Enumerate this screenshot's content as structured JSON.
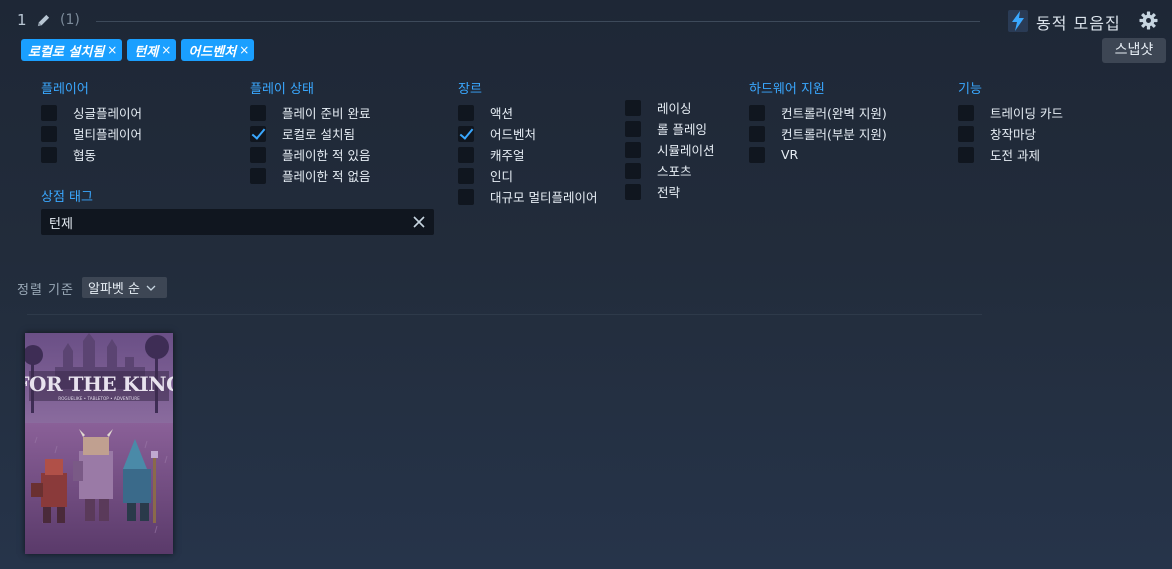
{
  "header": {
    "shelf_number": "1",
    "shelf_count": "(1)",
    "title": "동적 모음집",
    "snapshot_label": "스냅샷"
  },
  "chips": [
    {
      "label": "로컬로 설치됨",
      "remove": "×"
    },
    {
      "label": "턴제",
      "remove": "×"
    },
    {
      "label": "어드벤처",
      "remove": "×"
    }
  ],
  "filters": {
    "players": {
      "title": "플레이어",
      "options": [
        {
          "label": "싱글플레이어",
          "checked": false
        },
        {
          "label": "멀티플레이어",
          "checked": false
        },
        {
          "label": "협동",
          "checked": false
        }
      ]
    },
    "play_state": {
      "title": "플레이 상태",
      "options": [
        {
          "label": "플레이 준비 완료",
          "checked": false
        },
        {
          "label": "로컬로 설치됨",
          "checked": true
        },
        {
          "label": "플레이한 적 있음",
          "checked": false
        },
        {
          "label": "플레이한 적 없음",
          "checked": false
        }
      ]
    },
    "genre": {
      "title": "장르",
      "options_col1": [
        {
          "label": "액션",
          "checked": false
        },
        {
          "label": "어드벤처",
          "checked": true
        },
        {
          "label": "캐주얼",
          "checked": false
        },
        {
          "label": "인디",
          "checked": false
        },
        {
          "label": "대규모 멀티플레이어",
          "checked": false
        }
      ],
      "options_col2": [
        {
          "label": "레이싱",
          "checked": false
        },
        {
          "label": "롤 플레잉",
          "checked": false
        },
        {
          "label": "시뮬레이션",
          "checked": false
        },
        {
          "label": "스포츠",
          "checked": false
        },
        {
          "label": "전략",
          "checked": false
        }
      ]
    },
    "hardware": {
      "title": "하드웨어 지원",
      "options": [
        {
          "label": "컨트롤러(완벽 지원)",
          "checked": false
        },
        {
          "label": "컨트롤러(부분 지원)",
          "checked": false
        },
        {
          "label": "VR",
          "checked": false
        }
      ]
    },
    "features": {
      "title": "기능",
      "options": [
        {
          "label": "트레이딩 카드",
          "checked": false
        },
        {
          "label": "창작마당",
          "checked": false
        },
        {
          "label": "도전 과제",
          "checked": false
        }
      ]
    },
    "store_tags": {
      "title": "상점 태그",
      "value": "턴제"
    }
  },
  "sort": {
    "label": "정렬 기준",
    "selected": "알파벳 순"
  },
  "games": [
    {
      "title": "FOR THE KING",
      "subtitle": "ROGUELIKE • TABLETOP • ADVENTURE"
    }
  ],
  "colors": {
    "accent": "#1a9fff",
    "section_title": "#3aa8ff",
    "background": "#1e2736"
  }
}
